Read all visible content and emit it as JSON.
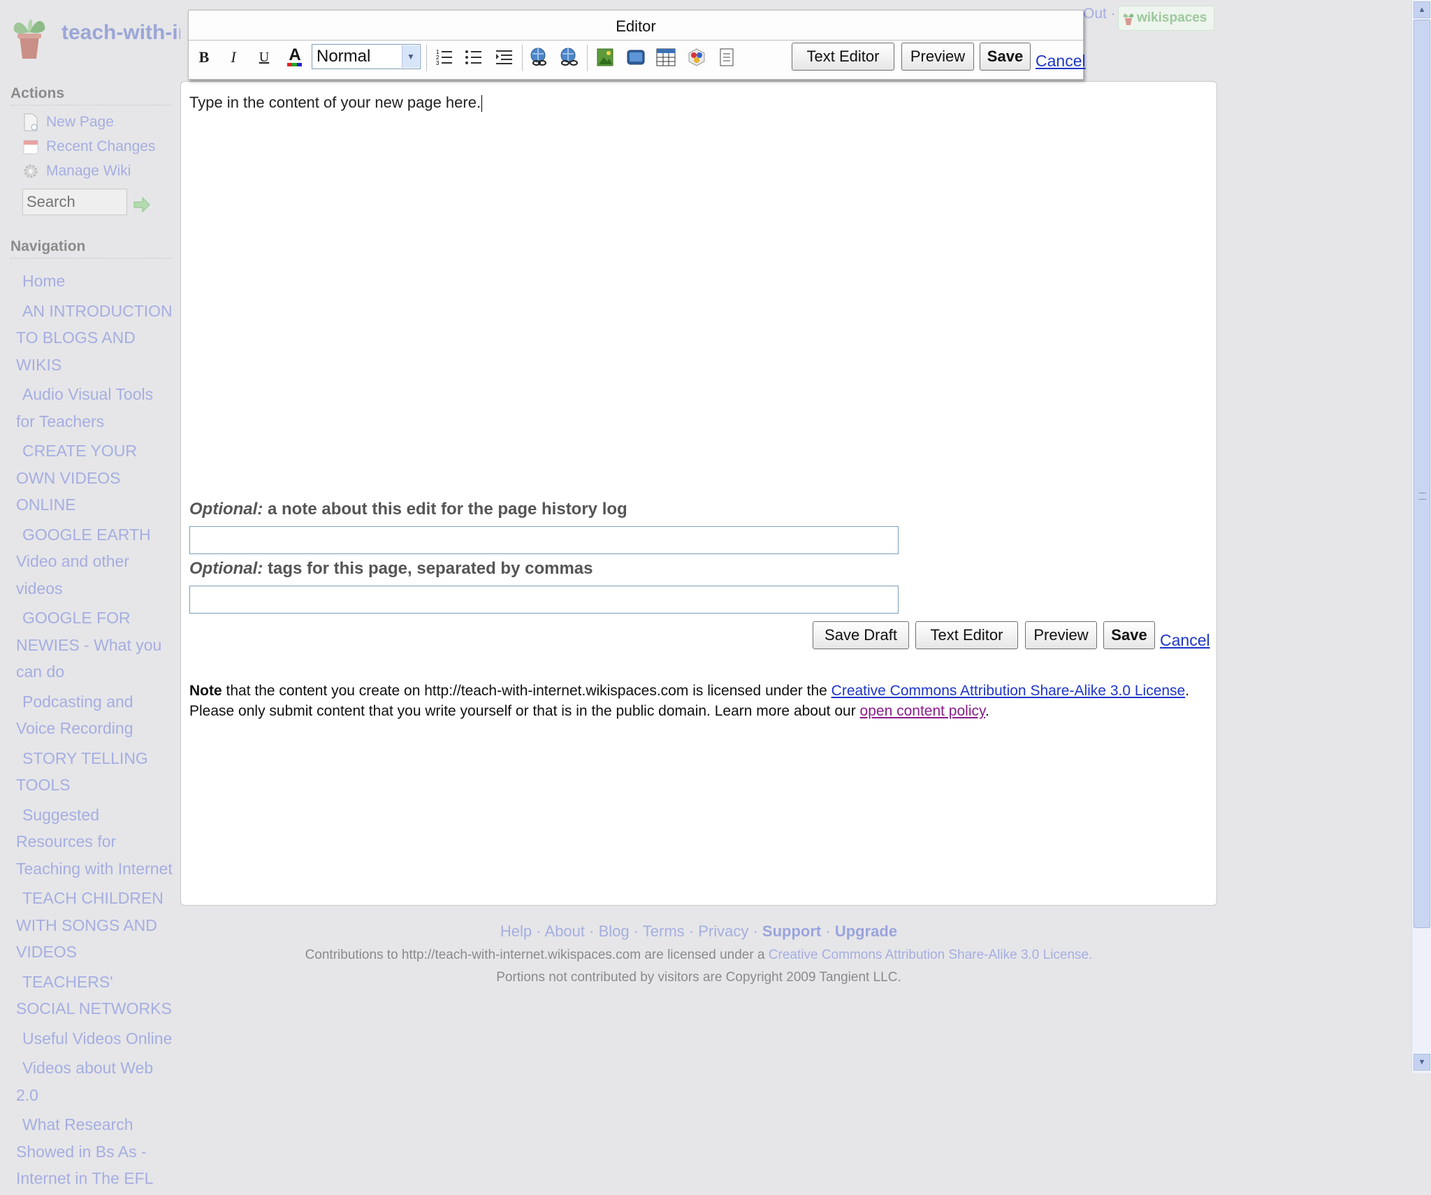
{
  "site": {
    "name": "teach-with-internet"
  },
  "userbar": {
    "visible_text": "Out ·",
    "badge": "wikispaces"
  },
  "sidebar": {
    "actions_heading": "Actions",
    "actions": [
      {
        "label": "New Page",
        "icon": "new-page-icon"
      },
      {
        "label": "Recent Changes",
        "icon": "calendar-icon"
      },
      {
        "label": "Manage Wiki",
        "icon": "gear-icon"
      }
    ],
    "search_placeholder": "Search",
    "navigation_heading": "Navigation",
    "nav_items": [
      "Home",
      "AN INTRODUCTION TO BLOGS AND WIKIS",
      "Audio Visual Tools for Teachers",
      "CREATE YOUR OWN VIDEOS ONLINE",
      "GOOGLE EARTH Video and other videos",
      "GOOGLE FOR NEWIES - What you can do",
      "Podcasting and Voice Recording",
      "STORY TELLING TOOLS",
      "Suggested Resources for Teaching with Internet",
      "TEACH CHILDREN WITH SONGS AND VIDEOS",
      "TEACHERS' SOCIAL NETWORKS",
      "Useful Videos Online",
      "Videos about Web 2.0",
      "What Research Showed in Bs As - Internet in The EFL"
    ]
  },
  "editor": {
    "toolbar_title": "Editor",
    "format_value": "Normal",
    "text_editor_label": "Text Editor",
    "preview_label": "Preview",
    "save_label": "Save",
    "cancel_label": "Cancel",
    "content_placeholder": "Type in the content of your new page here."
  },
  "form": {
    "optional_word": "Optional:",
    "note_label": "a note about this edit for the page history log",
    "tags_label": "tags for this page, separated by commas",
    "save_draft_label": "Save Draft",
    "text_editor_label": "Text Editor",
    "preview_label": "Preview",
    "save_label": "Save",
    "cancel_label": "Cancel"
  },
  "license_note": {
    "note_word": "Note",
    "text1": " that the content you create on http://teach-with-internet.wikispaces.com is licensed under the ",
    "link1": "Creative Commons Attribution Share-Alike 3.0 License",
    "text2": ". Please only submit content that you write yourself or that is in the public domain. Learn more about our ",
    "link2": "open content policy",
    "text3": "."
  },
  "footer": {
    "links": [
      "Help",
      "About",
      "Blog",
      "Terms",
      "Privacy"
    ],
    "support": "Support",
    "upgrade": "Upgrade",
    "contrib_text": "Contributions to http://teach-with-internet.wikispaces.com are licensed under a ",
    "contrib_link": "Creative Commons Attribution Share-Alike 3.0 License",
    "contrib_end": ".",
    "copyright": "Portions not contributed by visitors are Copyright 2009 Tangient LLC."
  },
  "colors": {
    "link": "#1e36c9",
    "sidebar_link": "#a5aee0",
    "background": "#e6e6e9"
  }
}
